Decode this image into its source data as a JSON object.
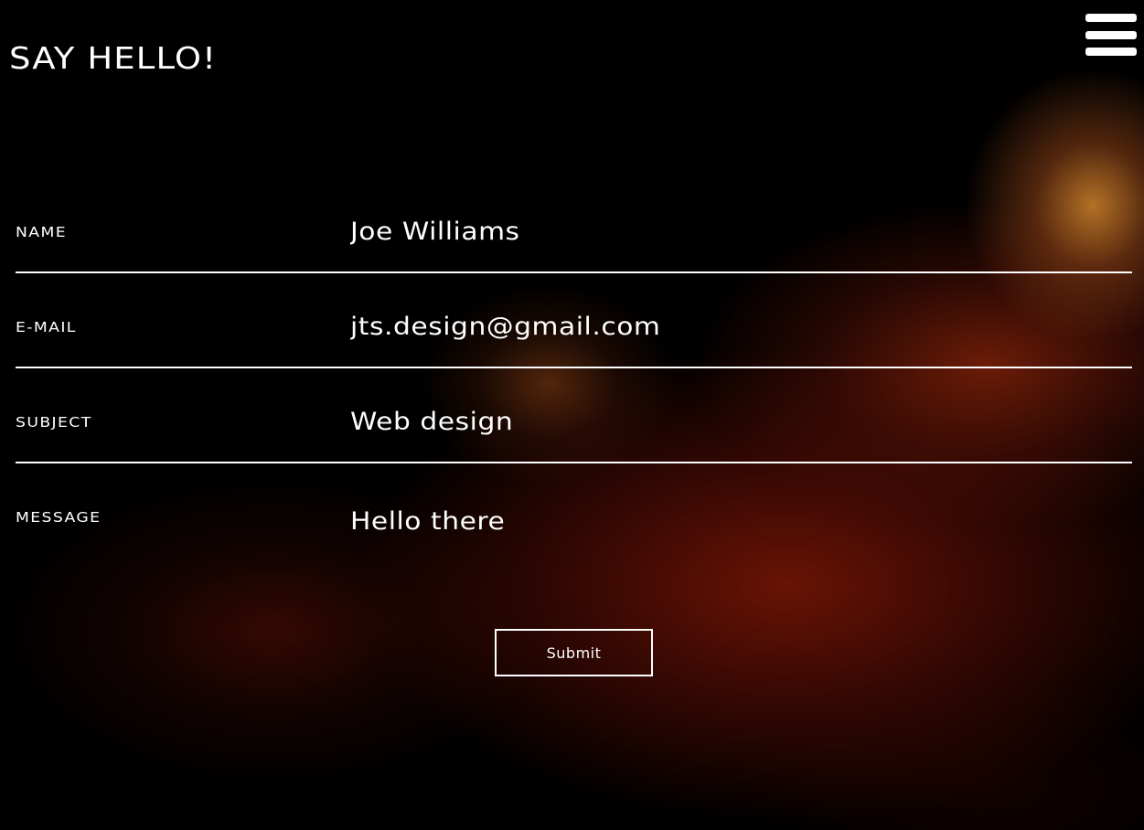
{
  "header": {
    "title": "SAY HELLO!",
    "menu_icon": "hamburger-menu-icon"
  },
  "form": {
    "fields": [
      {
        "label": "NAME",
        "value": "Joe Williams"
      },
      {
        "label": "E-MAIL",
        "value": "jts.design@gmail.com"
      },
      {
        "label": "SUBJECT",
        "value": "Web design"
      },
      {
        "label": "MESSAGE",
        "value": "Hello there"
      }
    ],
    "submit_label": "Submit"
  },
  "colors": {
    "text": "#ffffff",
    "background": "#000000",
    "accent_glow": "#b87828",
    "accent_red": "#6e1406"
  }
}
